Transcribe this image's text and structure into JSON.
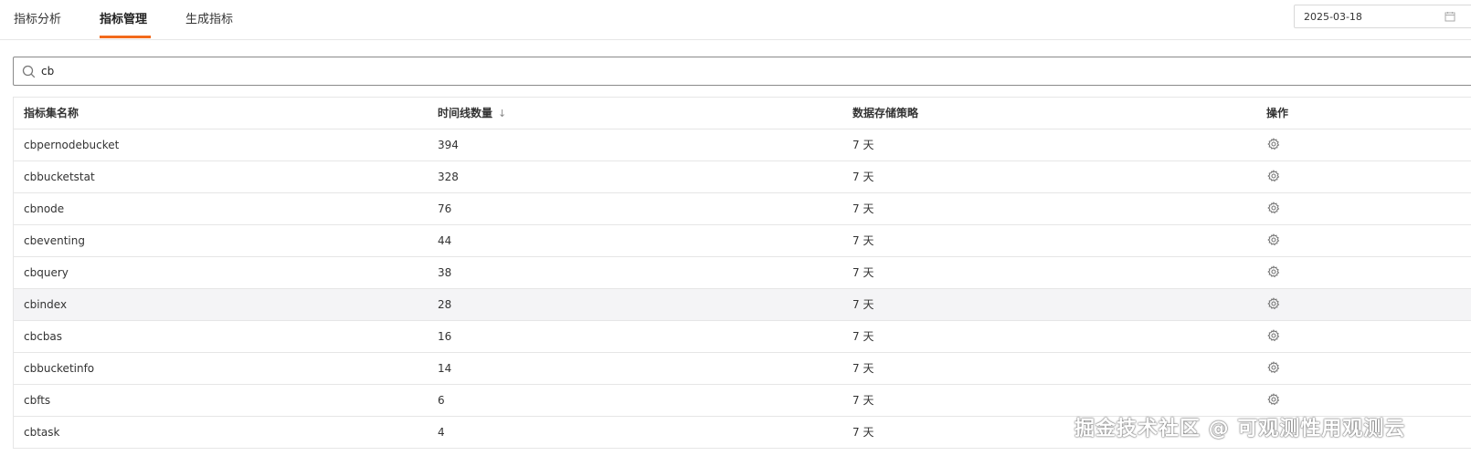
{
  "tabs": [
    {
      "label": "指标分析",
      "active": false
    },
    {
      "label": "指标管理",
      "active": true
    },
    {
      "label": "生成指标",
      "active": false
    }
  ],
  "date_picker": {
    "value": "2025-03-18",
    "icon": "calendar-icon"
  },
  "search": {
    "value": "cb",
    "icon": "search-icon"
  },
  "table": {
    "headers": [
      "指标集名称",
      "时间线数量",
      "数据存储策略",
      "操作"
    ],
    "sort_icon": "↓",
    "rows": [
      {
        "name": "cbpernodebucket",
        "count": "394",
        "policy": "7 天"
      },
      {
        "name": "cbbucketstat",
        "count": "328",
        "policy": "7 天"
      },
      {
        "name": "cbnode",
        "count": "76",
        "policy": "7 天"
      },
      {
        "name": "cbeventing",
        "count": "44",
        "policy": "7 天"
      },
      {
        "name": "cbquery",
        "count": "38",
        "policy": "7 天"
      },
      {
        "name": "cbindex",
        "count": "28",
        "policy": "7 天"
      },
      {
        "name": "cbcbas",
        "count": "16",
        "policy": "7 天"
      },
      {
        "name": "cbbucketinfo",
        "count": "14",
        "policy": "7 天"
      },
      {
        "name": "cbfts",
        "count": "6",
        "policy": "7 天"
      },
      {
        "name": "cbtask",
        "count": "4",
        "policy": "7 天"
      }
    ]
  },
  "watermark": "掘金技术社区 @ 可观测性用观测云",
  "colors": {
    "accent": "#f26a1b",
    "row_highlight": "#f4f4f6"
  }
}
